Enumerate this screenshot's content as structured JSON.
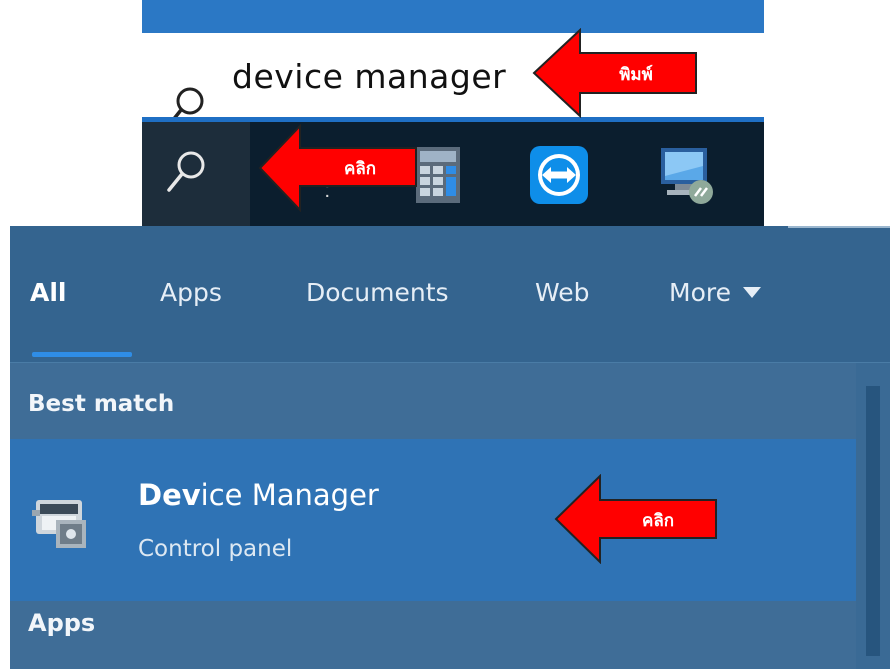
{
  "search_box": {
    "query": "device manager",
    "search_icon": "search-icon"
  },
  "taskbar": {
    "search_button_icon": "search-icon",
    "apps": [
      {
        "icon": "calculator-icon"
      },
      {
        "icon": "teamviewer-icon"
      },
      {
        "icon": "remote-desktop-icon"
      }
    ]
  },
  "results_panel": {
    "tabs": [
      {
        "label": "All"
      },
      {
        "label": "Apps"
      },
      {
        "label": "Documents"
      },
      {
        "label": "Web"
      },
      {
        "label": "More"
      }
    ],
    "best_match_label": "Best match",
    "best_result": {
      "title_bold": "Dev",
      "title_rest": "ice Manager",
      "subtitle": "Control panel",
      "icon": "device-manager-icon"
    },
    "apps_label": "Apps"
  },
  "annotations": {
    "type_arrow_label": "พิมพ์",
    "click_arrow_label_taskbar": "คลิก",
    "click_arrow_label_result": "คลิก",
    "arrow_color": "#ff0000"
  }
}
